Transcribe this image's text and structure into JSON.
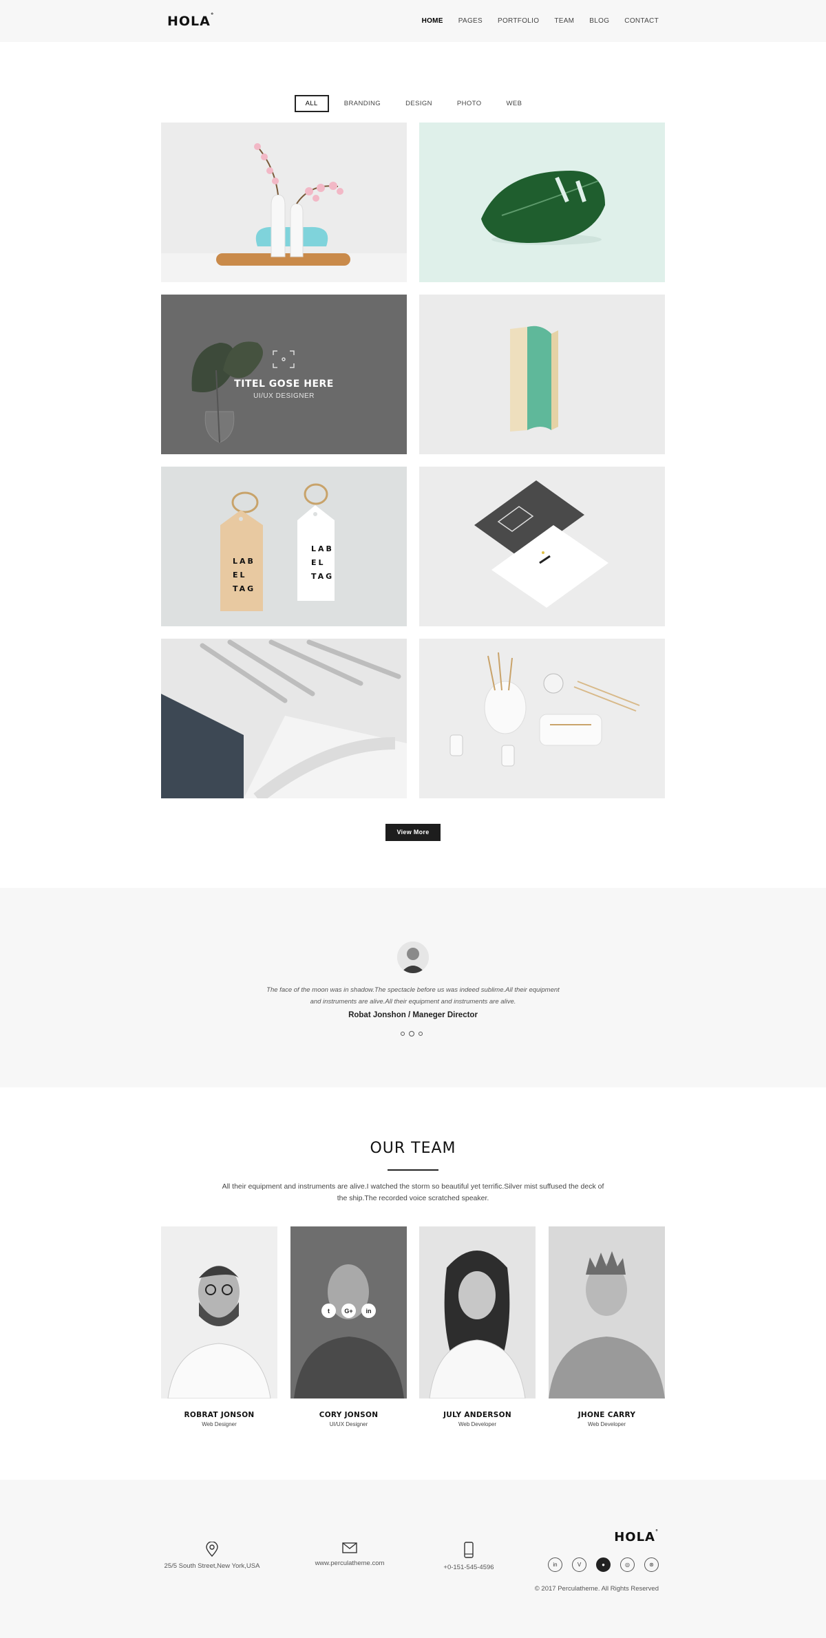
{
  "header": {
    "logo": "HOLA",
    "nav": [
      "HOME",
      "PAGES",
      "PORTFOLIO",
      "TEAM",
      "BLOG",
      "CONTACT"
    ]
  },
  "filters": [
    "ALL",
    "BRANDING",
    "DESIGN",
    "PHOTO",
    "WEB"
  ],
  "portfolio": {
    "hover_title": "TITEL GOSE HERE",
    "hover_subtitle": "UI/UX DESIGNER",
    "label_tag_lines": [
      "LAB",
      "EL",
      "TAG"
    ],
    "view_more": "View More"
  },
  "testimonial": {
    "quote": "The face of the moon was in shadow.The spectacle before us was indeed sublime.All their equipment and instruments are alive.All their equipment and instruments are alive.",
    "author": "Robat Jonshon / Maneger Director"
  },
  "team": {
    "heading": "OUR TEAM",
    "description": "All their equipment and instruments are alive.I watched the storm so beautiful yet terrific.Silver mist suffused the deck of the ship.The recorded voice scratched  speaker.",
    "members": [
      {
        "name": "ROBRAT JONSON",
        "role": "Web Designer"
      },
      {
        "name": "CORY JONSON",
        "role": "UI/UX Designer"
      },
      {
        "name": "JULY ANDERSON",
        "role": "Web Developer"
      },
      {
        "name": "JHONE CARRY",
        "role": "Web Developer"
      }
    ],
    "social_labels": [
      "t",
      "G+",
      "in"
    ]
  },
  "footer": {
    "address": "25/5 South Street,New York,USA",
    "website": "www.perculatheme.com",
    "phone": "+0-151-545-4596",
    "logo": "HOLA",
    "social_labels": [
      "in",
      "V",
      "●",
      "◎",
      "⊛"
    ],
    "copyright": "© 2017 Perculatheme. All Rights Reserved"
  },
  "colors": {
    "header_bg": "#f7f7f7",
    "button_bg": "#1d1d1d",
    "overlay": "#6a6a6a"
  }
}
